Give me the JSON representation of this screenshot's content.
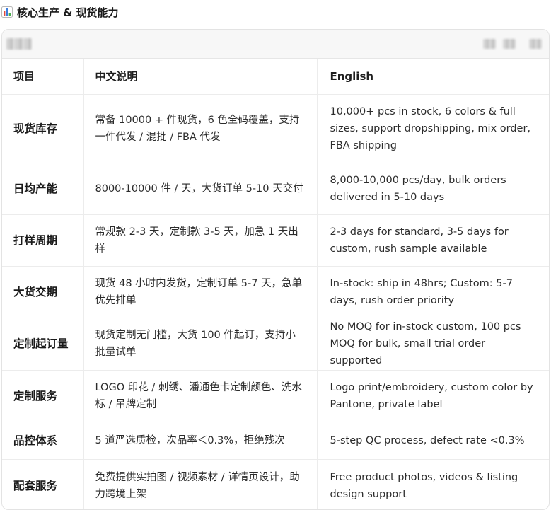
{
  "heading": {
    "icon": "bar-chart-icon",
    "title": "核心生产 & 现货能力"
  },
  "colors": {
    "icon_red": "#e04a3f",
    "icon_blue": "#3b7ddd",
    "icon_green": "#4caf50",
    "border": "#ececec"
  },
  "table": {
    "headers": [
      "项目",
      "中文说明",
      "English"
    ],
    "rows": [
      {
        "item": "现货库存",
        "zh": "常备 10000 + 件现货，6 色全码覆盖，支持一件代发 / 混批 / FBA 代发",
        "en": "10,000+ pcs in stock, 6 colors & full sizes, support dropshipping, mix order, FBA shipping"
      },
      {
        "item": "日均产能",
        "zh": "8000-10000 件 / 天，大货订单 5-10 天交付",
        "en": "8,000-10,000 pcs/day, bulk orders delivered in 5-10 days"
      },
      {
        "item": "打样周期",
        "zh": "常规款 2-3 天，定制款 3-5 天，加急 1 天出样",
        "en": "2-3 days for standard, 3-5 days for custom, rush sample available"
      },
      {
        "item": "大货交期",
        "zh": "现货 48 小时内发货，定制订单 5-7 天，急单优先排单",
        "en": "In-stock: ship in 48hrs; Custom: 5-7 days, rush order priority"
      },
      {
        "item": "定制起订量",
        "zh": "现货定制无门槛，大货 100 件起订，支持小批量试单",
        "en": "No MOQ for in-stock custom, 100 pcs MOQ for bulk, small trial order supported"
      },
      {
        "item": "定制服务",
        "zh": "LOGO 印花 / 刺绣、潘通色卡定制颜色、洗水标 / 吊牌定制",
        "en": "Logo print/embroidery, custom color by Pantone, private label"
      },
      {
        "item": "品控体系",
        "zh": "5 道严选质检，次品率＜0.3%，拒绝残次",
        "en": "5-step QC process, defect rate <0.3%"
      },
      {
        "item": "配套服务",
        "zh": "免费提供实拍图 / 视频素材 / 详情页设计，助力跨境上架",
        "en": "Free product photos, videos & listing design support"
      }
    ]
  }
}
